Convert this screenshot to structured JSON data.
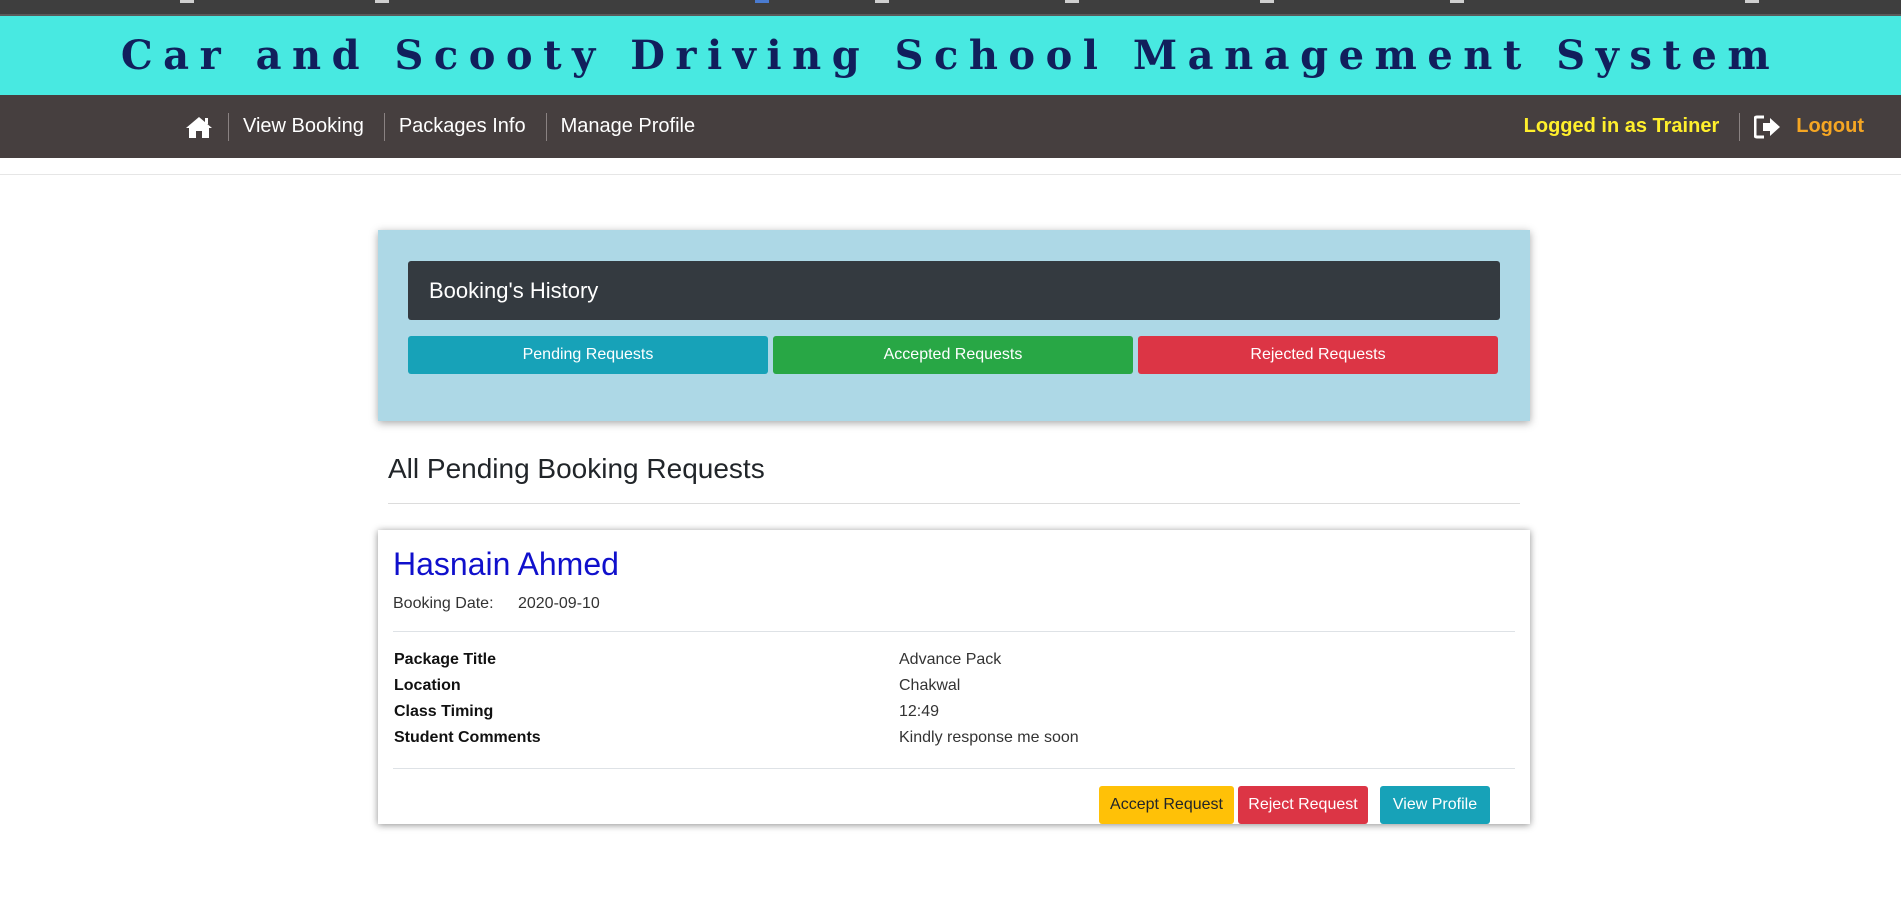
{
  "app": {
    "title": "Car and Scooty Driving School Management System"
  },
  "nav": {
    "home_icon": "home-icon",
    "links": [
      "View Booking",
      "Packages Info",
      "Manage Profile"
    ],
    "logged_in_text": "Logged in as Trainer",
    "logout_icon": "sign-out-icon",
    "logout_label": "Logout"
  },
  "history": {
    "header": "Booking's History",
    "tabs": {
      "pending": "Pending Requests",
      "accepted": "Accepted Requests",
      "rejected": "Rejected Requests"
    }
  },
  "section": {
    "title": "All Pending Booking Requests"
  },
  "booking": {
    "student_name": "Hasnain Ahmed",
    "date_label": "Booking Date:",
    "date_value": "2020-09-10",
    "details": [
      {
        "label": "Package Title",
        "value": "Advance Pack"
      },
      {
        "label": "Location",
        "value": "Chakwal"
      },
      {
        "label": "Class Timing",
        "value": "12:49"
      },
      {
        "label": "Student Comments",
        "value": "Kindly response me soon"
      }
    ],
    "actions": {
      "accept": "Accept Request",
      "reject": "Reject Request",
      "view": "View Profile"
    }
  },
  "colors": {
    "title_bg": "#48e9e1",
    "nav_bg": "#463f3f",
    "history_bg": "#add8e6",
    "pending": "#17a2b8",
    "accepted": "#28a745",
    "rejected": "#dc3545",
    "accept_btn": "#ffc107",
    "name_color": "#1010cc"
  }
}
